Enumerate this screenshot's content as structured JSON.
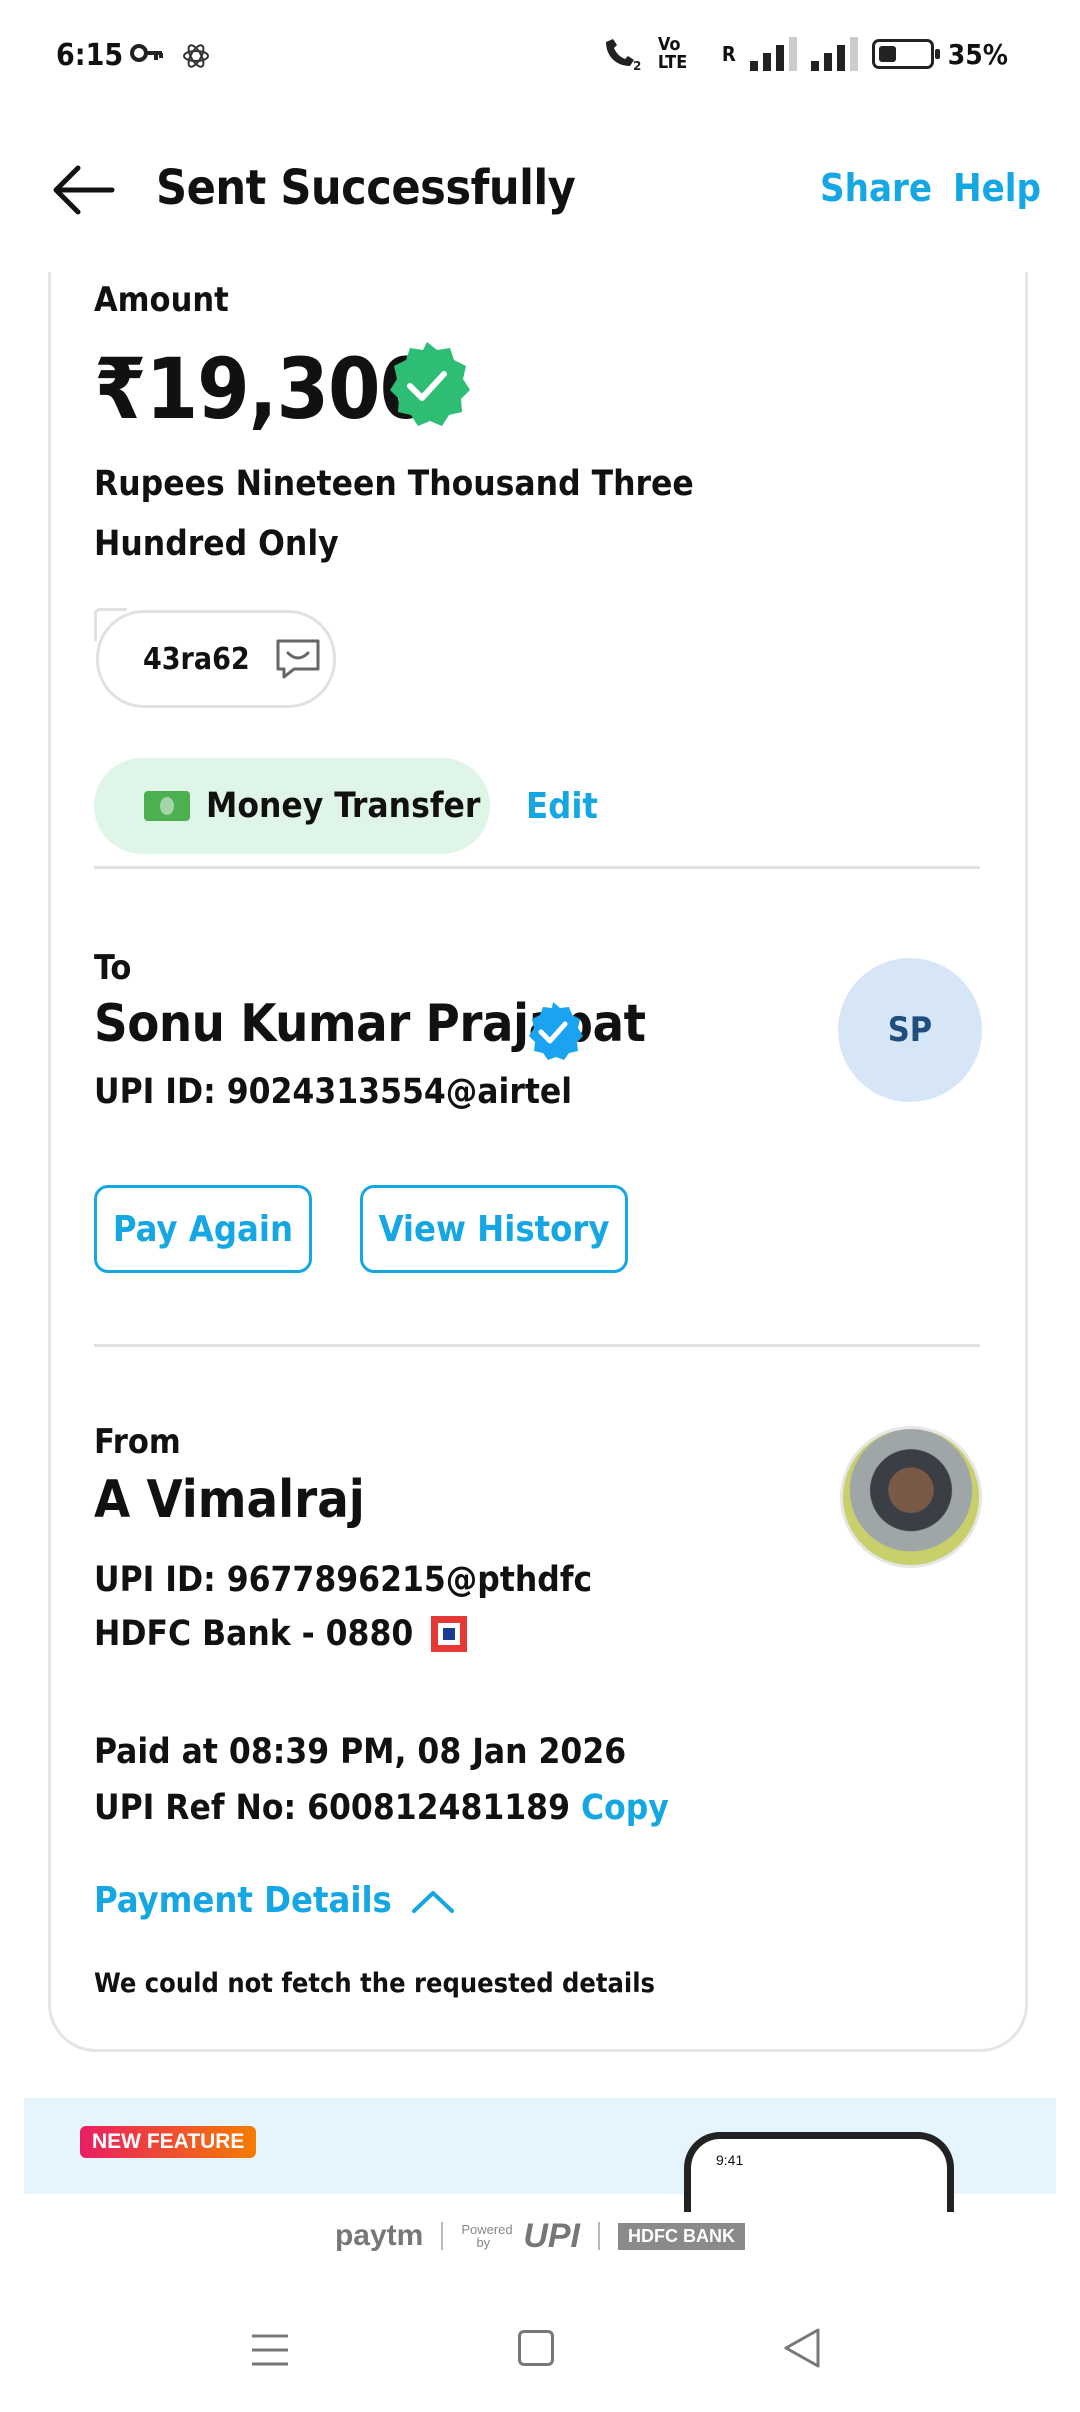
{
  "status_bar": {
    "time": "6:15",
    "volte": "Vo LTE",
    "roaming": "R",
    "battery_pct": "35%",
    "battery_level": 0.35
  },
  "header": {
    "title": "Sent Successfully",
    "share_label": "Share",
    "help_label": "Help"
  },
  "amount_section": {
    "label": "Amount",
    "amount": "₹19,300",
    "amount_words": "Rupees Nineteen Thousand Three Hundred Only",
    "note": "43ra62",
    "category": "Money Transfer",
    "edit_label": "Edit"
  },
  "to": {
    "label": "To",
    "name": "Sonu Kumar Prajapat",
    "upi_id": "UPI ID: 9024313554@airtel",
    "initials": "SP",
    "pay_again_label": "Pay Again",
    "view_history_label": "View History"
  },
  "from": {
    "label": "From",
    "name": "A Vimalraj",
    "upi_id": "UPI ID: 9677896215@pthdfc",
    "bank": "HDFC Bank - 0880",
    "paid_at": "Paid at 08:39 PM, 08 Jan 2026",
    "ref_no": "UPI Ref No: 600812481189",
    "copy_label": "Copy"
  },
  "payment_details": {
    "label": "Payment Details",
    "message": "We could not fetch the requested details"
  },
  "banner": {
    "badge": "NEW FEATURE",
    "phone_time": "9:41"
  },
  "footer": {
    "paytm": "paytm",
    "powered_by": "Powered by",
    "upi": "UPI",
    "bank": "HDFC BANK"
  },
  "colors": {
    "accent": "#14a7e3",
    "success": "#2dbd74",
    "verified_blue": "#1aa3f0"
  }
}
